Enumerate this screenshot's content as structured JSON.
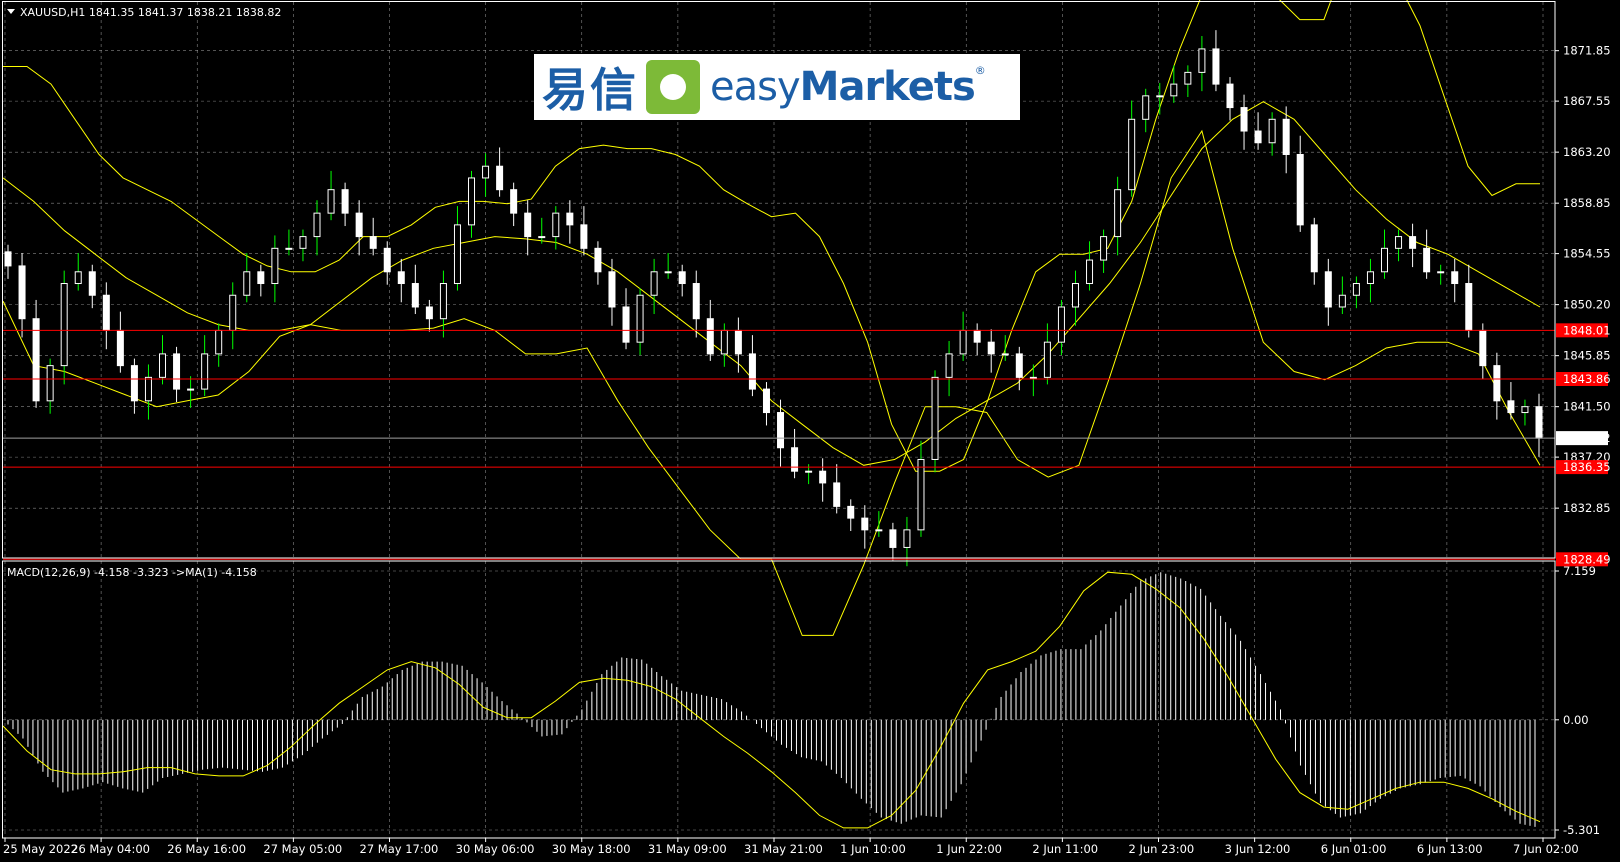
{
  "header": {
    "symbol_label": "XAUUSD,H1  1841.35 1841.37 1838.21 1838.82",
    "indicator_label": "MACD(12,26,9) -4.158 -3.323  ->MA(1) -4.158"
  },
  "logo": {
    "cn_text": "易信",
    "easy_text": "easy",
    "markets_text": "Markets",
    "reg_mark": "®"
  },
  "colors": {
    "background": "#000000",
    "grid": "#c0c0c0",
    "candle": "#ffffff",
    "bull_wick": "#00ff00",
    "bands": "#ffff00",
    "hline": "#ff0000",
    "price_label_bg": "#ff0000"
  },
  "chart_data": [
    {
      "type": "candlestick",
      "symbol": "XAUUSD",
      "timeframe": "H1",
      "last": {
        "open": 1841.35,
        "high": 1841.37,
        "low": 1838.21,
        "close": 1838.82
      },
      "ylim": [
        1828.6,
        1876.0
      ],
      "y_ticks": [
        "1871.85",
        "1867.55",
        "1863.20",
        "1858.85",
        "1854.55",
        "1850.20",
        "1845.85",
        "1841.50",
        "1837.20",
        "1832.85"
      ],
      "x_ticks": [
        "25 May 2022",
        "26 May 04:00",
        "26 May 16:00",
        "27 May 05:00",
        "27 May 17:00",
        "30 May 06:00",
        "30 May 18:00",
        "31 May 09:00",
        "31 May 21:00",
        "1 Jun 10:00",
        "1 Jun 22:00",
        "2 Jun 11:00",
        "2 Jun 23:00",
        "3 Jun 12:00",
        "6 Jun 01:00",
        "6 Jun 13:00",
        "7 Jun 02:00"
      ],
      "horizontal_lines": [
        "1848.01",
        "1843.86",
        "1836.35",
        "1828.49"
      ],
      "current_price": "1838.82",
      "close_path": [
        1853.5,
        1849,
        1842,
        1845,
        1852,
        1853,
        1851,
        1848,
        1845,
        1842,
        1844,
        1846,
        1843,
        1843,
        1846,
        1848,
        1851,
        1853,
        1852,
        1855,
        1855,
        1856,
        1858,
        1860,
        1858,
        1856,
        1855,
        1853,
        1852,
        1850,
        1849,
        1852,
        1857,
        1861,
        1862,
        1860,
        1858,
        1856,
        1856,
        1858,
        1857,
        1855,
        1853,
        1850,
        1847,
        1851,
        1853,
        1853,
        1852,
        1849,
        1846,
        1848,
        1846,
        1843,
        1841,
        1838,
        1836,
        1836,
        1835,
        1833,
        1832,
        1831,
        1831,
        1829.5,
        1831,
        1837,
        1844,
        1846,
        1848,
        1847,
        1846,
        1846,
        1844,
        1844,
        1847,
        1850,
        1852,
        1854,
        1856,
        1860,
        1866,
        1868,
        1868,
        1869,
        1870,
        1872,
        1869,
        1867,
        1865,
        1864,
        1866,
        1863,
        1857,
        1853,
        1850,
        1851,
        1852,
        1853,
        1855,
        1856,
        1855,
        1853,
        1853,
        1852,
        1848,
        1845,
        1842,
        1841,
        1841.5,
        1838.82
      ],
      "upper_band": [
        1870.5,
        1870.5,
        1869,
        1866,
        1863,
        1861,
        1860,
        1859,
        1857.5,
        1856,
        1854.5,
        1853.5,
        1853,
        1853,
        1854,
        1856,
        1856,
        1857,
        1858.5,
        1859,
        1859,
        1858.8,
        1859.2,
        1862,
        1863.5,
        1863.8,
        1863.5,
        1863.5,
        1863,
        1862,
        1860,
        1858.8,
        1857.7,
        1858,
        1856,
        1852,
        1847,
        1840,
        1836,
        1836,
        1837,
        1842,
        1848,
        1853,
        1854.5,
        1854.5,
        1855,
        1859,
        1866,
        1872,
        1877,
        1878,
        1878,
        1876.5,
        1874.5,
        1874.5,
        1880,
        1880,
        1878,
        1874,
        1868,
        1862,
        1859.5,
        1860.5,
        1860.5
      ],
      "middle_band": [
        1861,
        1859,
        1856.5,
        1854.5,
        1852.5,
        1851,
        1849.5,
        1848.5,
        1848,
        1848,
        1848.5,
        1850.5,
        1852.5,
        1854,
        1855,
        1855.5,
        1856,
        1855.8,
        1855.5,
        1854.5,
        1853,
        1851,
        1849,
        1847,
        1845,
        1842,
        1840,
        1838,
        1836.5,
        1837,
        1838.5,
        1840.5,
        1842,
        1843.5,
        1846,
        1849,
        1852,
        1855.5,
        1859.5,
        1863.5,
        1866,
        1867.5,
        1866,
        1863,
        1860,
        1857.5,
        1855.5,
        1854.5,
        1853,
        1851.5,
        1850
      ],
      "lower_band": [
        1850.5,
        1845,
        1844.5,
        1843.5,
        1842.5,
        1841.5,
        1842,
        1842.5,
        1844.5,
        1847.5,
        1848.5,
        1848,
        1848,
        1848,
        1848.2,
        1849,
        1848,
        1846,
        1846,
        1846.5,
        1842,
        1838,
        1834.5,
        1831,
        1828.5,
        1828.5,
        1822,
        1822,
        1828,
        1835,
        1841.5,
        1841.5,
        1841,
        1837,
        1835.5,
        1836.5,
        1844,
        1852,
        1861,
        1865,
        1855,
        1847,
        1844.5,
        1843.8,
        1845,
        1846.5,
        1847,
        1847,
        1846,
        1841,
        1836.5
      ],
      "macd": {
        "ylim": [
          -5.301,
          7.159
        ],
        "y_ticks": [
          "7.159",
          "0.00",
          "-5.301"
        ],
        "histogram": [
          0,
          -0.9,
          -2.5,
          -3.5,
          -3.3,
          -3.0,
          -3.3,
          -3.5,
          -2.8,
          -2.6,
          -2.4,
          -2.3,
          -2.4,
          -2.5,
          -2.3,
          -1.7,
          -0.9,
          -0.2,
          1.1,
          1.6,
          2.4,
          2.8,
          2.8,
          2.6,
          1.8,
          0.9,
          0.1,
          -0.8,
          -0.7,
          0.5,
          2.2,
          3.0,
          2.9,
          2.1,
          1.4,
          1.2,
          1.0,
          0.4,
          -0.4,
          -1.2,
          -1.8,
          -2.0,
          -2.8,
          -3.8,
          -4.7,
          -5.0,
          -4.6,
          -4.7,
          -3.1,
          -1.0,
          1.1,
          2.3,
          3.1,
          3.4,
          3.4,
          4.3,
          5.5,
          6.7,
          7.1,
          6.8,
          6.3,
          5.0,
          3.8,
          2.2,
          0.5,
          -2.2,
          -4.0,
          -4.7,
          -4.5,
          -3.8,
          -3.3,
          -3.1,
          -2.8,
          -2.7,
          -3.2,
          -4.2,
          -5.0,
          -5.2
        ],
        "signal": [
          -0.3,
          -1.5,
          -2.4,
          -2.6,
          -2.6,
          -2.5,
          -2.3,
          -2.3,
          -2.6,
          -2.7,
          -2.7,
          -2.2,
          -1.3,
          -0.2,
          0.8,
          1.6,
          2.4,
          2.8,
          2.5,
          1.7,
          0.6,
          0.1,
          0.1,
          0.9,
          1.8,
          2.0,
          1.9,
          1.6,
          1.0,
          0.1,
          -0.8,
          -1.6,
          -2.5,
          -3.5,
          -4.6,
          -5.2,
          -5.2,
          -4.6,
          -3.4,
          -1.4,
          0.8,
          2.4,
          2.8,
          3.3,
          4.5,
          6.2,
          7.1,
          7.0,
          6.3,
          5.4,
          3.9,
          2.1,
          0.1,
          -1.9,
          -3.5,
          -4.2,
          -4.3,
          -3.8,
          -3.3,
          -3.0,
          -3.0,
          -3.3,
          -3.8,
          -4.4,
          -4.9
        ]
      }
    }
  ]
}
